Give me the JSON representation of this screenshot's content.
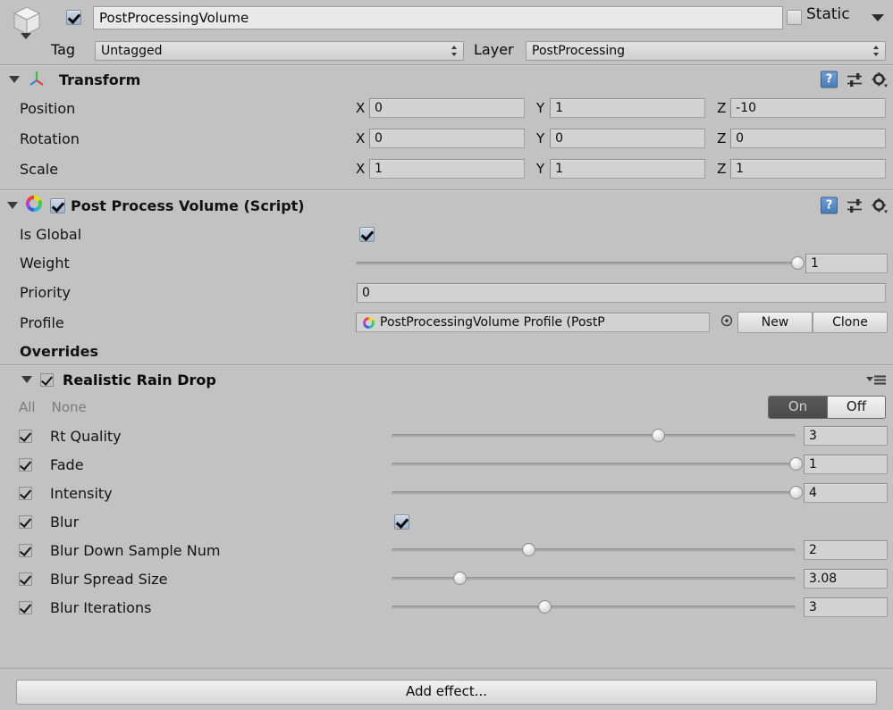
{
  "header": {
    "object_icon": "cube-icon",
    "enabled_checkbox": true,
    "name": "PostProcessingVolume",
    "static_label": "Static",
    "static_checked": false,
    "tag_label": "Tag",
    "tag_value": "Untagged",
    "layer_label": "Layer",
    "layer_value": "PostProcessing"
  },
  "transform": {
    "title": "Transform",
    "expanded": true,
    "icons": [
      "help-icon",
      "preset-icon",
      "gear-icon"
    ],
    "rows": [
      {
        "label": "Position",
        "x": "0",
        "y": "1",
        "z": "-10"
      },
      {
        "label": "Rotation",
        "x": "0",
        "y": "0",
        "z": "0"
      },
      {
        "label": "Scale",
        "x": "1",
        "y": "1",
        "z": "1"
      }
    ],
    "axis_labels": {
      "x": "X",
      "y": "Y",
      "z": "Z"
    }
  },
  "post_process_volume": {
    "title": "Post Process Volume (Script)",
    "expanded": true,
    "enabled": true,
    "icons": [
      "help-icon",
      "preset-icon",
      "gear-icon"
    ],
    "is_global": {
      "label": "Is Global",
      "checked": true
    },
    "weight": {
      "label": "Weight",
      "value": "1",
      "slider_pct": 100
    },
    "priority": {
      "label": "Priority",
      "value": "0"
    },
    "profile": {
      "label": "Profile",
      "value": "PostProcessingVolume Profile (PostP",
      "new_label": "New",
      "clone_label": "Clone"
    },
    "overrides_label": "Overrides"
  },
  "effect": {
    "title": "Realistic Rain Drop",
    "expanded": true,
    "enabled": true,
    "menu_icon": "menu-icon",
    "all_label": "All",
    "none_label": "None",
    "on_label": "On",
    "off_label": "Off",
    "toggle_state": "Off",
    "properties": [
      {
        "label": "Rt Quality",
        "override": true,
        "type": "slider",
        "value": "3",
        "slider_pct": 66
      },
      {
        "label": "Fade",
        "override": true,
        "type": "slider",
        "value": "1",
        "slider_pct": 100
      },
      {
        "label": "Intensity",
        "override": true,
        "type": "slider",
        "value": "4",
        "slider_pct": 100
      },
      {
        "label": "Blur",
        "override": true,
        "type": "checkbox",
        "checked": true
      },
      {
        "label": "Blur Down Sample Num",
        "override": true,
        "type": "slider",
        "value": "2",
        "slider_pct": 34
      },
      {
        "label": "Blur Spread Size",
        "override": true,
        "type": "slider",
        "value": "3.08",
        "slider_pct": 17
      },
      {
        "label": "Blur Iterations",
        "override": true,
        "type": "slider",
        "value": "3",
        "slider_pct": 38
      }
    ]
  },
  "footer": {
    "add_effect_label": "Add effect..."
  },
  "colors": {
    "background": "#c2c2c2",
    "field": "#d2d2d2",
    "accent_blue": "#4b7cb4",
    "toggle_on_bg": "#4f4f4f"
  }
}
